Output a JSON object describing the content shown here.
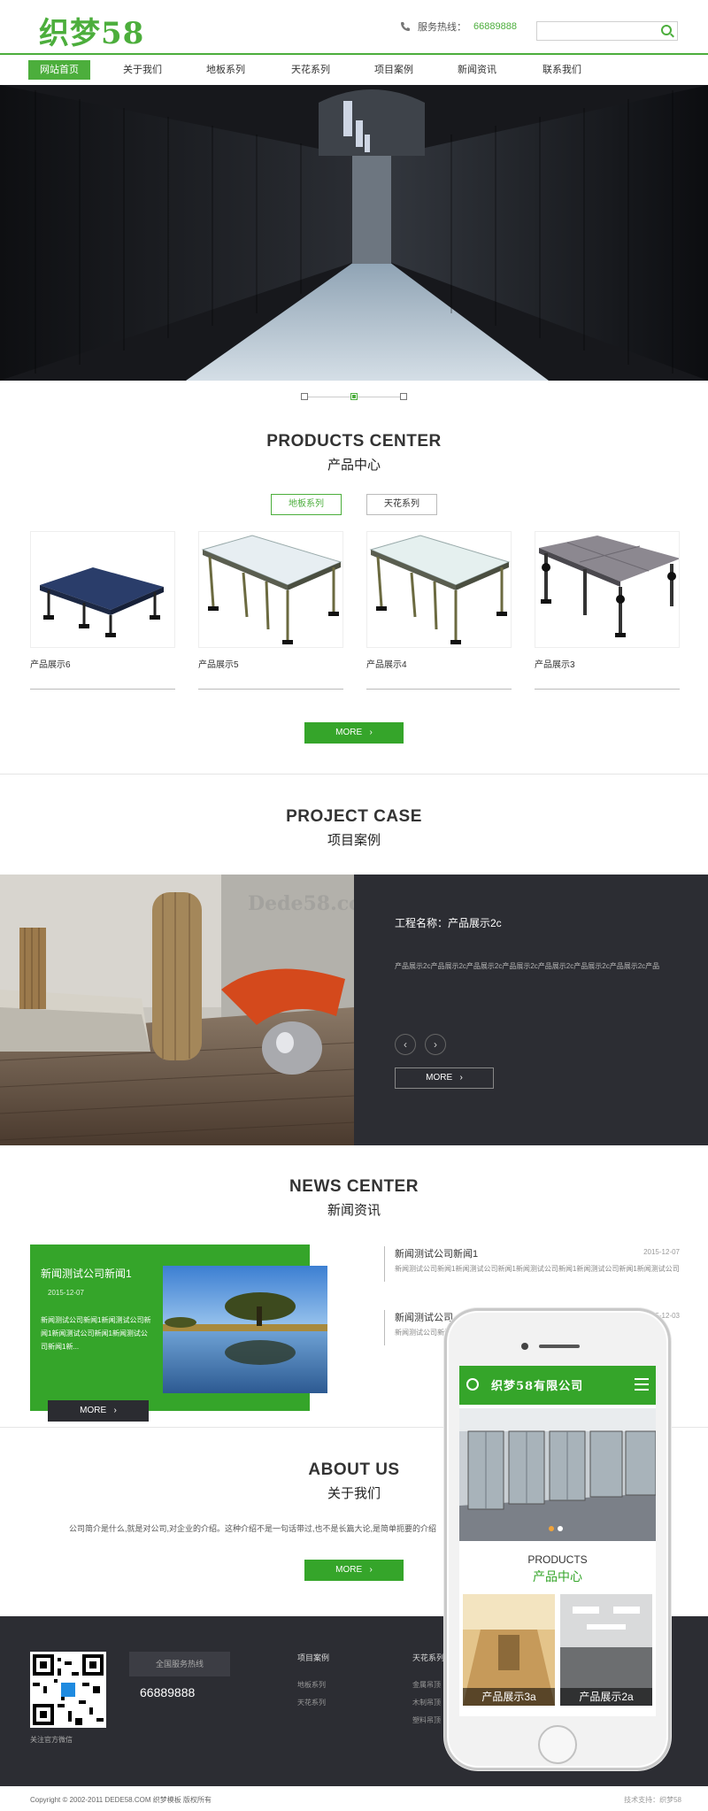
{
  "header": {
    "logo": "织梦58",
    "hotline_label": "服务热线：",
    "hotline_number": "66889888"
  },
  "nav": [
    "网站首页",
    "关于我们",
    "地板系列",
    "天花系列",
    "项目案例",
    "新闻资讯",
    "联系我们"
  ],
  "products": {
    "title_en": "PRODUCTS CENTER",
    "title_cn": "产品中心",
    "tabs": [
      "地板系列",
      "天花系列"
    ],
    "items": [
      "产品展示6",
      "产品展示5",
      "产品展示4",
      "产品展示3"
    ],
    "more": "MORE"
  },
  "cases": {
    "title_en": "PROJECT CASE",
    "title_cn": "项目案例",
    "project_title": "工程名称：产品展示2c",
    "project_desc": "产品展示2c产品展示2c产品展示2c产品展示2c产品展示2c产品展示2c产品展示2c产品",
    "watermark": "Dede58.com",
    "more": "MORE"
  },
  "news": {
    "title_en": "NEWS CENTER",
    "title_cn": "新闻资讯",
    "featured": {
      "title": "新闻测试公司新闻1",
      "date": "2015-12-07",
      "summary": "新闻测试公司新闻1新闻测试公司新闻1新闻测试公司新闻1新闻测试公司新闻1新..."
    },
    "more": "MORE",
    "list": [
      {
        "title": "新闻测试公司新闻1",
        "date": "2015-12-07",
        "summary": "新闻测试公司新闻1新闻测试公司新闻1新闻测试公司新闻1新闻测试公司新闻1新闻测试公司新闻1新..."
      },
      {
        "title": "新闻测试公司",
        "date": "2015-12-03",
        "summary": "新闻测试公司新闻1新闻测试公司新闻1新闻测试公司新闻1新闻测试公司新闻"
      }
    ]
  },
  "about": {
    "title_en": "ABOUT US",
    "title_cn": "关于我们",
    "text": "公司简介是什么,就是对公司,对企业的介绍。这种介绍不是一句话带过,也不是长篇大论,是简单扼要的介绍",
    "more": "MORE"
  },
  "footer": {
    "qr_caption": "关注官方微信",
    "hotline_label": "全国服务热线",
    "hotline_number": "66889888",
    "col1": {
      "title": "项目案例",
      "links": [
        "地板系列",
        "天花系列"
      ]
    },
    "col2": {
      "title": "天花系列",
      "links": [
        "金属吊顶",
        "木制吊顶",
        "塑料吊顶"
      ]
    },
    "copyright": "Copyright © 2002-2011 DEDE58.COM 织梦模板 版权所有",
    "support": "技术支持：织梦58"
  },
  "phone": {
    "site_name": "织梦58有限公司",
    "products_en": "PRODUCTS",
    "products_cn": "产品中心",
    "cards": [
      "产品展示3a",
      "产品展示2a"
    ]
  },
  "colors": {
    "brand_green": "#35a52a",
    "dark": "#2c2d33"
  }
}
